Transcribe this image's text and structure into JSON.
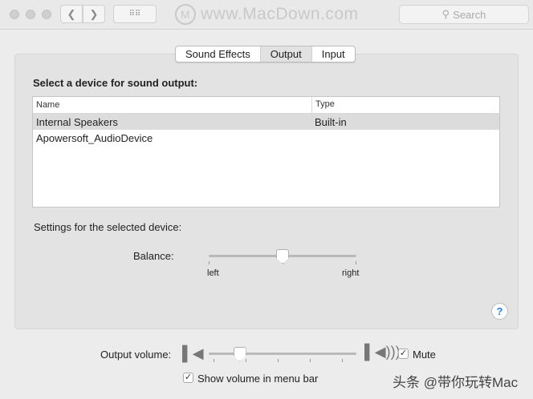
{
  "window": {
    "search_placeholder": "Search",
    "watermark": "www.MacDown.com",
    "watermark_logo": "M"
  },
  "tabs": [
    {
      "label": "Sound Effects"
    },
    {
      "label": "Output",
      "selected": true
    },
    {
      "label": "Input"
    }
  ],
  "output": {
    "heading": "Select a device for sound output:",
    "columns": [
      "Name",
      "Type"
    ],
    "devices": [
      {
        "name": "Internal Speakers",
        "type": "Built-in",
        "selected": true
      },
      {
        "name": "Apowersoft_AudioDevice",
        "type": ""
      }
    ],
    "settings_label": "Settings for the selected device:",
    "balance": {
      "label": "Balance:",
      "left": "left",
      "right": "right",
      "value": 0.5
    },
    "help": "?"
  },
  "volume": {
    "label": "Output volume:",
    "value": 0.21,
    "mute_label": "Mute",
    "mute_checked": true,
    "show_in_menu_label": "Show volume in menu bar",
    "show_in_menu_checked": true
  },
  "credit": "头条 @带你玩转Mac"
}
